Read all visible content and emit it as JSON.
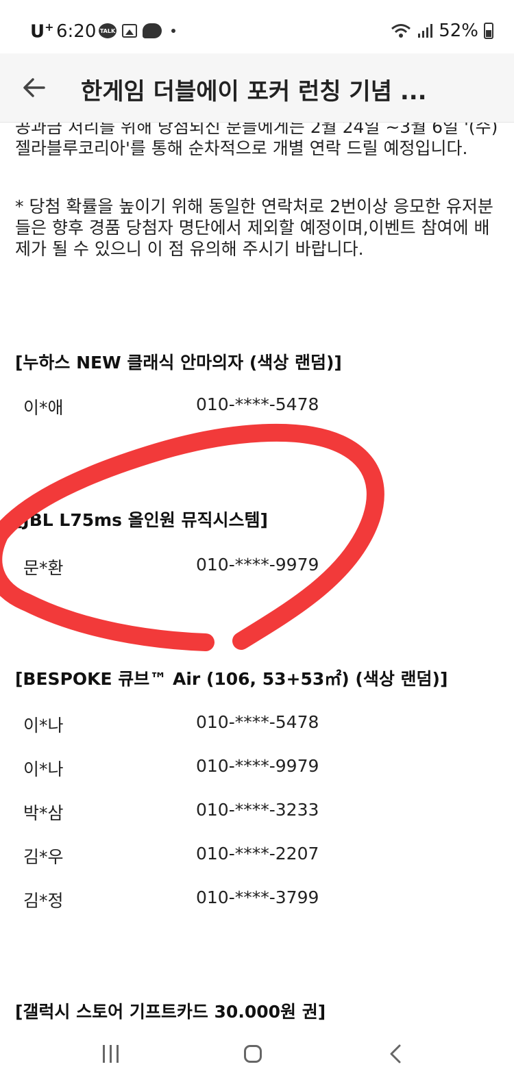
{
  "status_bar": {
    "carrier": "U",
    "carrier_sup": "+",
    "time": "6:20",
    "talk_badge": "TALK",
    "battery": "52%"
  },
  "app_bar": {
    "title": "한게임 더블에이 포커 런칭 기념 ..."
  },
  "content": {
    "para_top_line1": "공과금 처리를 위해 당첨되신 분들에게는 2월 24일 ~3월 6일 '(수)",
    "para_top_line2": "젤라블루코리아'를 통해 순차적으로 개별 연락 드릴 예정입니다.",
    "notice": "* 당첨 확률을 높이기 위해 동일한 연락처로 2번이상 응모한 유저분들은 향후 경품 당첨자 명단에서 제외할 예정이며,이벤트 참여에 배제가 될 수 있으니 이 점 유의해 주시기 바랍니다.",
    "sections": [
      {
        "title": "[누하스 NEW 클래식 안마의자 (색상 랜덤)]",
        "winners": [
          {
            "name": "이*애",
            "phone": "010-****-5478"
          }
        ]
      },
      {
        "title": "[JBL L75ms 올인원 뮤직시스템]",
        "winners": [
          {
            "name": "문*환",
            "phone": "010-****-9979"
          }
        ]
      },
      {
        "title": "[BESPOKE 큐브™ Air (106, 53+53㎡) (색상 랜덤)]",
        "winners": [
          {
            "name": "이*나",
            "phone": "010-****-5478"
          },
          {
            "name": "이*나",
            "phone": "010-****-9979"
          },
          {
            "name": "박*삼",
            "phone": "010-****-3233"
          },
          {
            "name": "김*우",
            "phone": "010-****-2207"
          },
          {
            "name": "김*정",
            "phone": "010-****-3799"
          }
        ]
      },
      {
        "title": "[갤럭시 스토어 기프트카드 30.000원 권]",
        "winners": []
      }
    ]
  },
  "annotation": {
    "circle_color": "#f23a3a"
  },
  "icons": [
    "talk-icon",
    "gallery-icon",
    "cloud-icon",
    "wifi-icon",
    "signal-icon",
    "battery-icon",
    "back-arrow-icon",
    "recents-icon",
    "home-icon",
    "nav-back-icon"
  ]
}
